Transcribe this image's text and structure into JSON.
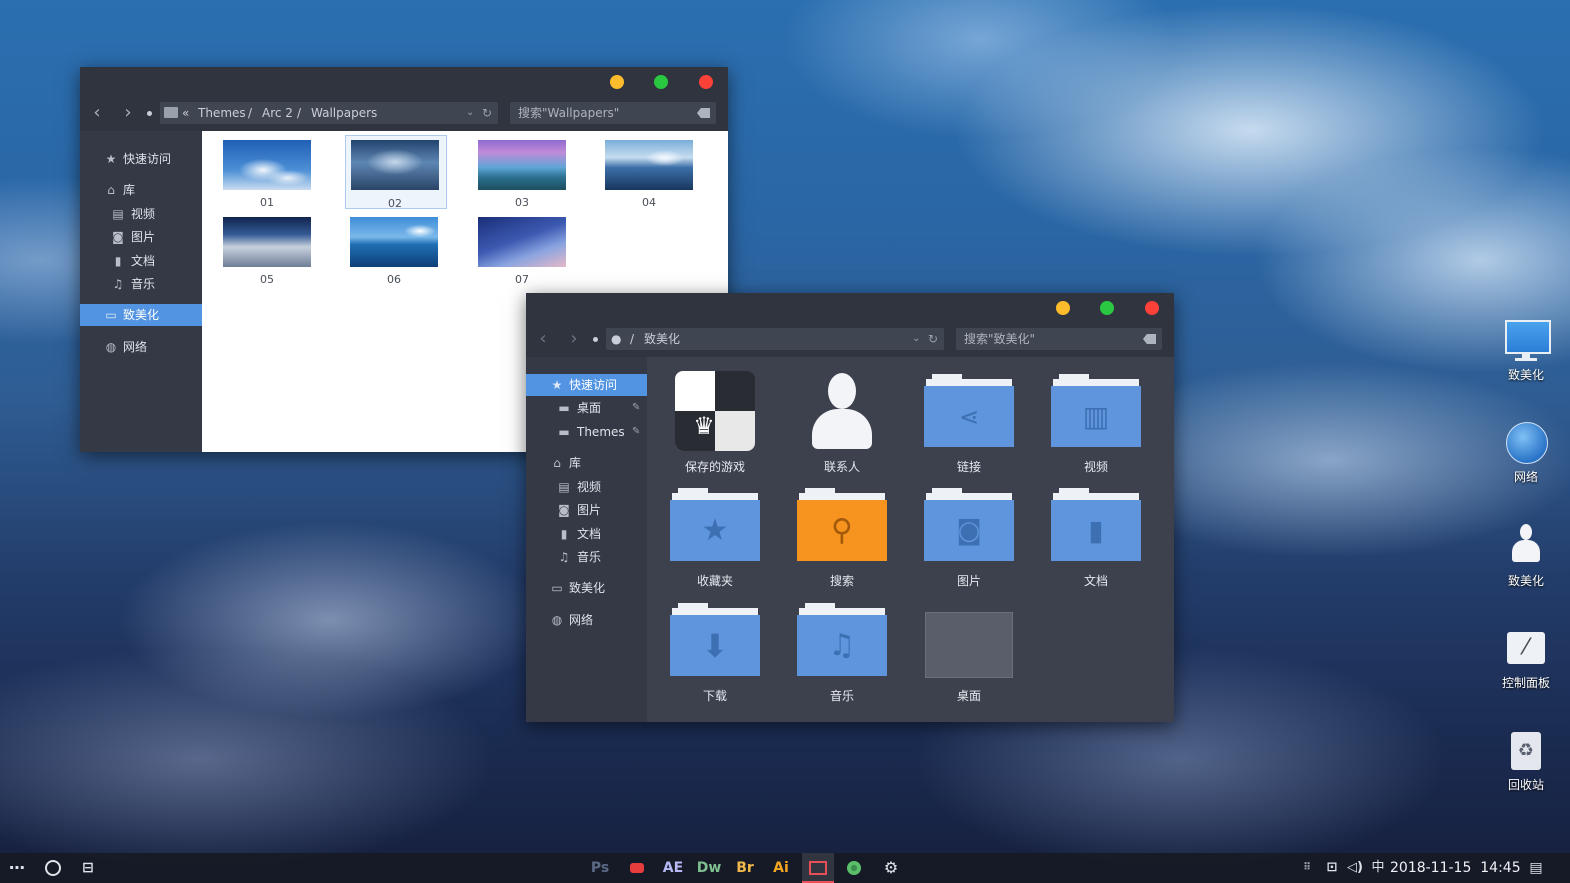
{
  "window1": {
    "breadcrumb": {
      "prefix": "«",
      "crumbs": [
        "Themes",
        "Arc 2",
        "Wallpapers"
      ],
      "sep": "/"
    },
    "search_placeholder": "搜索\"Wallpapers\"",
    "sidebar": {
      "quick": "快速访问",
      "lib": "库",
      "video": "视频",
      "pictures": "图片",
      "docs": "文档",
      "music": "音乐",
      "zhimeihua": "致美化",
      "network": "网络"
    },
    "thumbs": [
      "01",
      "02",
      "03",
      "04",
      "05",
      "06",
      "07"
    ]
  },
  "window2": {
    "breadcrumb": {
      "sep": "/",
      "crumb": "致美化"
    },
    "search_placeholder": "搜索\"致美化\"",
    "sidebar": {
      "quick": "快速访问",
      "desktop": "桌面",
      "themes": "Themes",
      "lib": "库",
      "video": "视频",
      "pictures": "图片",
      "docs": "文档",
      "music": "音乐",
      "zhimeihua": "致美化",
      "network": "网络"
    },
    "items": {
      "saved_games": "保存的游戏",
      "contacts": "联系人",
      "links": "链接",
      "videos": "视频",
      "favorites": "收藏夹",
      "searches": "搜索",
      "pictures": "图片",
      "documents": "文档",
      "downloads": "下载",
      "music": "音乐",
      "desktop": "桌面"
    }
  },
  "desktop_icons": {
    "computer": "致美化",
    "network": "网络",
    "user": "致美化",
    "control_panel": "控制面板",
    "recycle_bin": "回收站"
  },
  "taskbar": {
    "apps": {
      "ps": "Ps",
      "ae": "AE",
      "dw": "Dw",
      "br": "Br",
      "ai": "Ai"
    },
    "ime": "中",
    "datetime": "2018-11-15  14:45"
  },
  "colors": {
    "close": "#fc4138",
    "minimize": "#fdbc2b",
    "maximize": "#2ac840",
    "accent": "#5294e2",
    "folder": "#5e95dd",
    "search_folder": "#f79420"
  }
}
